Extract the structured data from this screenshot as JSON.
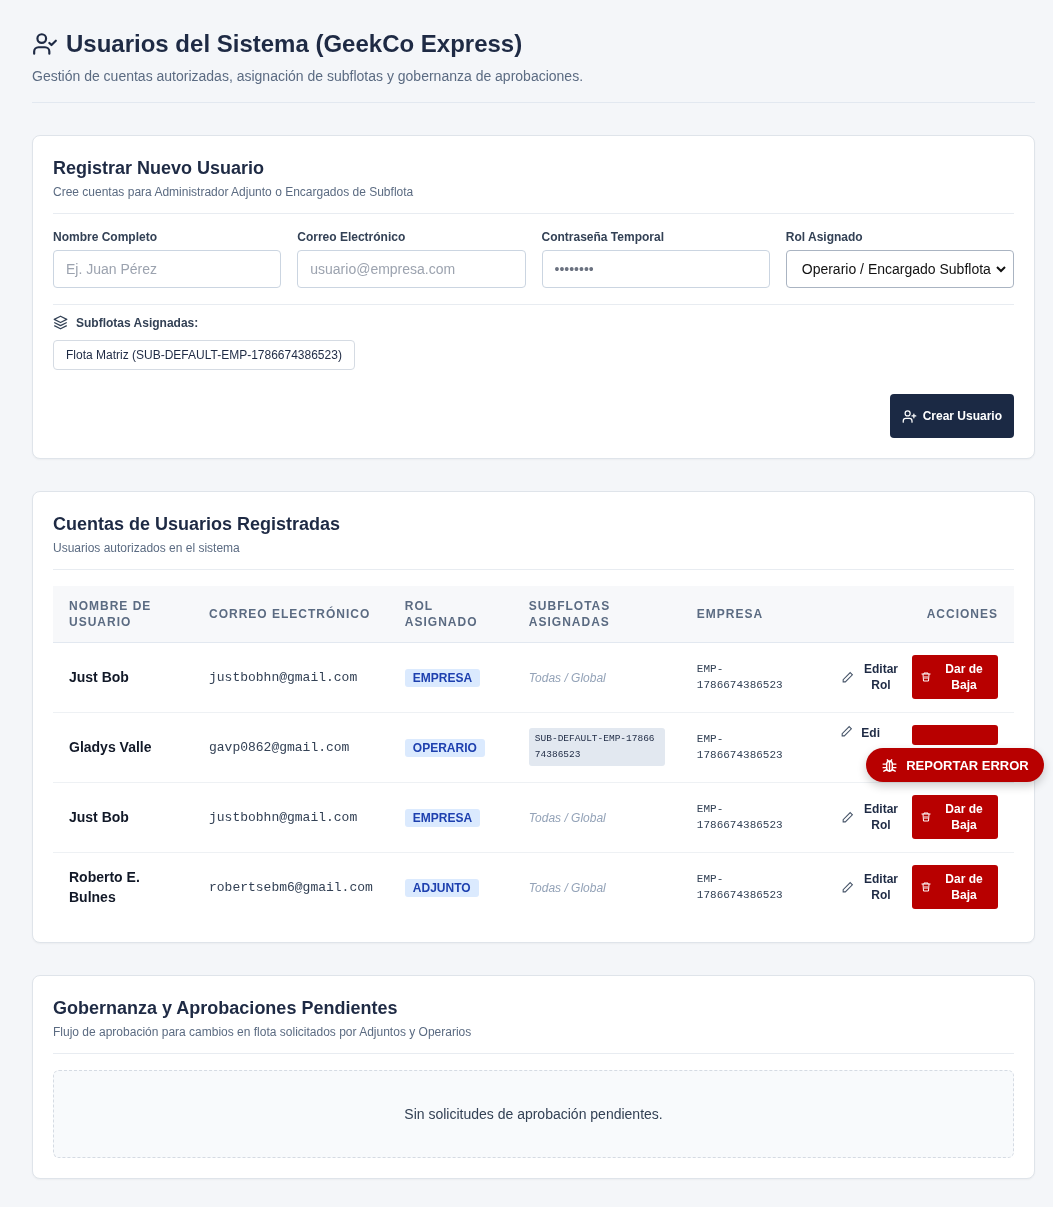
{
  "header": {
    "title": "Usuarios del Sistema (GeekCo Express)",
    "subtitle": "Gestión de cuentas autorizadas, asignación de subflotas y gobernanza de aprobaciones."
  },
  "register": {
    "title": "Registrar Nuevo Usuario",
    "subtitle": "Cree cuentas para Administrador Adjunto o Encargados de Subflota",
    "fields": [
      {
        "kind": "text",
        "label": "Nombre Completo",
        "placeholder": "Ej. Juan Pérez"
      },
      {
        "kind": "text",
        "label": "Correo Electrónico",
        "placeholder": "usuario@empresa.com"
      },
      {
        "kind": "password",
        "label": "Contraseña Temporal",
        "value": "••••••••"
      },
      {
        "kind": "select",
        "label": "Rol Asignado",
        "value": "Operario / Encargado Subflota"
      }
    ],
    "subfleets_label": "Subflotas Asignadas:",
    "subfleets": [
      "Flota Matriz (SUB-DEFAULT-EMP-1786674386523)"
    ],
    "submit": "Crear Usuario"
  },
  "accounts": {
    "title": "Cuentas de Usuarios Registradas",
    "subtitle": "Usuarios autorizados en el sistema",
    "columns": [
      "NOMBRE DE USUARIO",
      "CORREO ELECTRÓNICO",
      "ROL ASIGNADO",
      "SUBFLOTAS ASIGNADAS",
      "EMPRESA",
      "ACCIONES"
    ],
    "rows": [
      {
        "name": "Just Bob",
        "email": "justbobhn@gmail.com",
        "role": "EMPRESA",
        "tagged": false,
        "subfleet": "Todas / Global",
        "company": "EMP-1786674386523",
        "edit": "Editar Rol",
        "delete": "Dar de Baja"
      },
      {
        "name": "Gladys Valle",
        "email": "gavp0862@gmail.com",
        "role": "OPERARIO",
        "tagged": true,
        "subfleet": "SUB-DEFAULT-EMP-1786674386523",
        "company": "EMP-1786674386523",
        "edit": "Edi"
      },
      {
        "name": "Just Bob",
        "email": "justbobhn@gmail.com",
        "role": "EMPRESA",
        "tagged": false,
        "subfleet": "Todas / Global",
        "company": "EMP-1786674386523",
        "edit": "Editar Rol",
        "delete": "Dar de Baja"
      },
      {
        "name": "Roberto E. Bulnes",
        "email": "robertsebm6@gmail.com",
        "role": "ADJUNTO",
        "tagged": false,
        "subfleet": "Todas / Global",
        "company": "EMP-1786674386523",
        "edit": "Editar Rol",
        "delete": "Dar de Baja"
      }
    ]
  },
  "governance": {
    "title": "Gobernanza y Aprobaciones Pendientes",
    "subtitle": "Flujo de aprobación para cambios en flota solicitados por Adjuntos y Operarios",
    "empty": "Sin solicitudes de aprobación pendientes."
  },
  "report_button": "REPORTAR ERROR"
}
